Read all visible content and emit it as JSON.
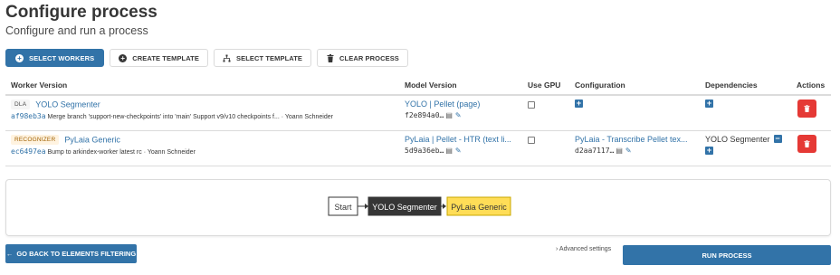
{
  "header": {
    "title": "Configure process",
    "subtitle": "Configure and run a process"
  },
  "toolbar": {
    "select_workers": "SELECT WORKERS",
    "create_template": "CREATE TEMPLATE",
    "select_template": "SELECT TEMPLATE",
    "clear_process": "CLEAR PROCESS"
  },
  "table": {
    "columns": [
      "Worker Version",
      "Model Version",
      "Use GPU",
      "Configuration",
      "Dependencies",
      "Actions"
    ],
    "rows": [
      {
        "tag": "DLA",
        "name": "YOLO Segmenter",
        "hash": "af98eb3a",
        "commit": "Merge branch 'support-new-checkpoints' into 'main' Support v9/v10 checkpoints f... · Yoann Schneider",
        "model_name": "YOLO | Pellet (page)",
        "model_hash": "f2e894a0…",
        "use_gpu": false,
        "config_name": "",
        "config_hash": "",
        "dependency": ""
      },
      {
        "tag": "RECOGNIZER",
        "name": "PyLaia Generic",
        "hash": "ec6497ea",
        "commit": "Bump to arkindex-worker latest rc · Yoann Schneider",
        "model_name": "PyLaia | Pellet - HTR (text li...",
        "model_hash": "5d9a36eb…",
        "use_gpu": false,
        "config_name": "PyLaia - Transcribe Pellet tex...",
        "config_hash": "d2aa7117…",
        "dependency": "YOLO Segmenter"
      }
    ]
  },
  "graph": {
    "nodes": [
      "Start",
      "YOLO Segmenter",
      "PyLaia Generic"
    ],
    "colors": {
      "start": "#ffffff",
      "yolo": "#363636",
      "pylaia": "#ffdd57"
    }
  },
  "footer": {
    "back_label": "GO BACK TO ELEMENTS FILTERING",
    "advanced_label": "Advanced settings",
    "run_label": "RUN PROCESS"
  },
  "colors": {
    "primary": "#3273a8",
    "danger": "#e53935"
  }
}
